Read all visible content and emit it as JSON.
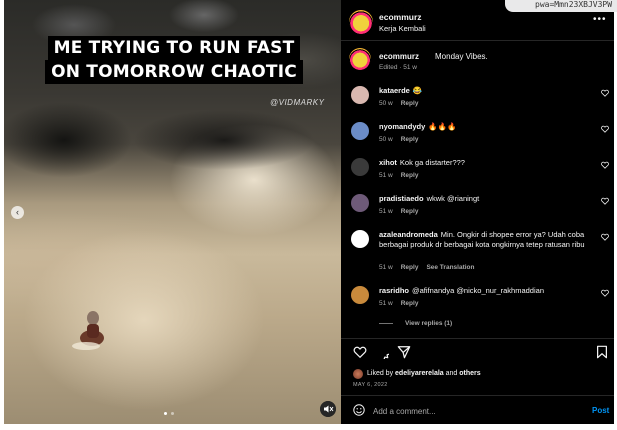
{
  "browser": {
    "url_fragment": "pwa=Mmn23XBJV3PW"
  },
  "video": {
    "caption_line1": "ME TRYING TO RUN FAST",
    "caption_line2": "ON TOMORROW CHAOTIC",
    "watermark": "@VIDMARKY"
  },
  "header": {
    "username": "ecommurz",
    "location": "Kerja Kembali",
    "more_icon": "more-horizontal-icon"
  },
  "caption": {
    "username": "ecommurz",
    "text": "Monday Vibes.",
    "meta": "Edited · 51 w"
  },
  "comments": [
    {
      "user": "kataerde",
      "text": "😂",
      "age": "50 w",
      "reply": "Reply",
      "avatar_color": "#d9b8b0"
    },
    {
      "user": "nyomandydy",
      "text": "🔥🔥🔥",
      "age": "50 w",
      "reply": "Reply",
      "avatar_color": "#6b8cc7"
    },
    {
      "user": "xihot",
      "text": "Kok ga distarter???",
      "age": "51 w",
      "reply": "Reply",
      "avatar_color": "#3a3a3a"
    },
    {
      "user": "pradistiaedo",
      "text": "wkwk @rianingt",
      "age": "51 w",
      "reply": "Reply",
      "avatar_color": "#6e5a78"
    },
    {
      "user": "azaleandromeda",
      "text": "Min. Ongkir di shopee error ya? Udah coba berbagai produk dr berbagai kota ongkirnya tetep ratusan ribu",
      "age": "51 w",
      "reply": "Reply",
      "see_translation": "See Translation",
      "avatar_color": "#ffffff"
    },
    {
      "user": "rasridho",
      "text": "@afifnandya @nicko_nur_rakhmaddian",
      "age": "51 w",
      "reply": "Reply",
      "avatar_color": "#c98a3c"
    }
  ],
  "view_replies": "View replies (1)",
  "actions": {
    "like_icon": "heart-icon",
    "comment_icon": "comment-icon",
    "share_icon": "send-icon",
    "save_icon": "bookmark-icon"
  },
  "likes": {
    "prefix": "Liked by",
    "user": "edeliyarerelala",
    "and": "and",
    "others": "others"
  },
  "date": "MAY 6, 2022",
  "comment_box": {
    "placeholder": "Add a comment...",
    "post_label": "Post"
  },
  "colors": {
    "accent": "#0095f6",
    "background": "#000000",
    "secondary_text": "#a8a8a8"
  }
}
